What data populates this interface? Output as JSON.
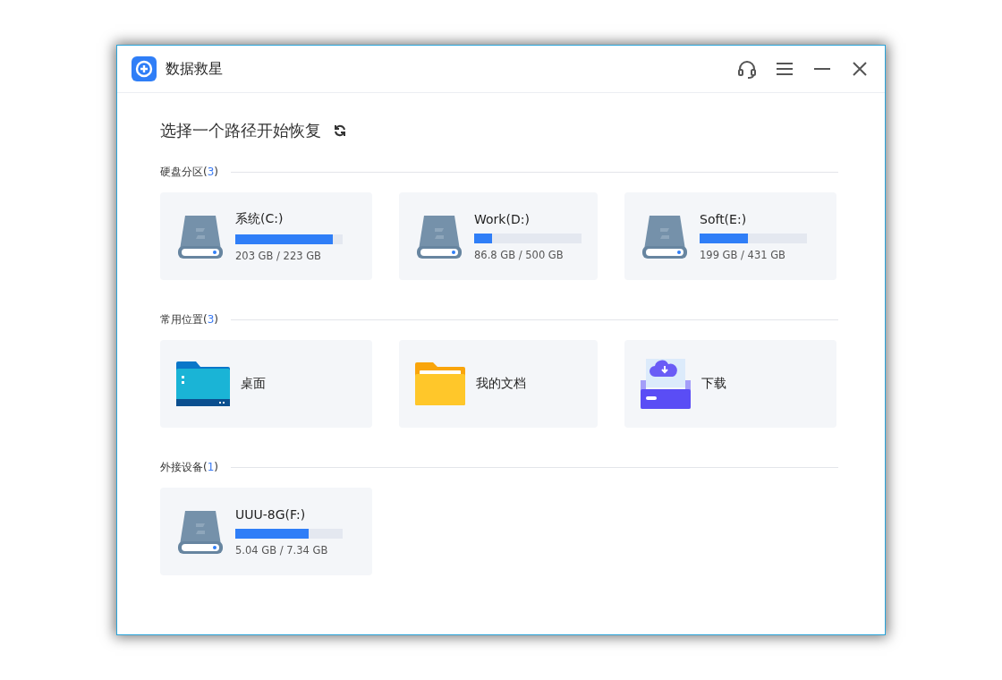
{
  "window": {
    "title": "数据救星"
  },
  "heading": "选择一个路径开始恢复",
  "sections": [
    {
      "label": "硬盘分区",
      "count": "(3)",
      "items": [
        {
          "kind": "drive",
          "name": "系统(C:)",
          "level": 0.91,
          "usage": "203 GB / 223 GB"
        },
        {
          "kind": "drive",
          "name": "Work(D:)",
          "level": 0.17,
          "usage": "86.8 GB / 500 GB"
        },
        {
          "kind": "drive",
          "name": "Soft(E:)",
          "level": 0.45,
          "usage": "199 GB / 431 GB"
        }
      ]
    },
    {
      "label": "常用位置",
      "count": "(3)",
      "items": [
        {
          "kind": "desktop",
          "name": "桌面"
        },
        {
          "kind": "documents",
          "name": "我的文档"
        },
        {
          "kind": "download",
          "name": "下载"
        }
      ]
    },
    {
      "label": "外接设备",
      "count": "(1)",
      "items": [
        {
          "kind": "drive",
          "name": "UUU-8G(F:)",
          "level": 0.68,
          "usage": "5.04 GB / 7.34 GB"
        }
      ]
    }
  ]
}
